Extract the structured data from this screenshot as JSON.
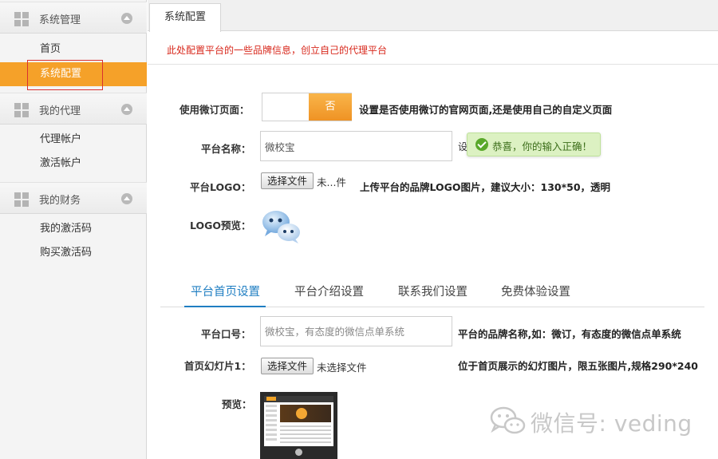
{
  "sidebar": {
    "sections": [
      {
        "title": "系统管理",
        "items": [
          "首页",
          "系统配置"
        ]
      },
      {
        "title": "我的代理",
        "items": [
          "代理帐户",
          "激活帐户"
        ]
      },
      {
        "title": "我的财务",
        "items": [
          "我的激活码",
          "购买激活码"
        ]
      }
    ],
    "active_item": "系统配置"
  },
  "tabbar": {
    "active_tab": "系统配置"
  },
  "notice": "此处配置平台的一些品牌信息，创立自己的代理平台",
  "form": {
    "use_custom_page": {
      "label": "使用微订页面：",
      "toggle_value": "否",
      "hint": "设置是否使用微订的官网页面,还是使用自己的自定义页面"
    },
    "platform_name": {
      "label": "平台名称：",
      "value": "微校宝",
      "hint_cut": "设",
      "success_tip": "恭喜，你的输入正确！"
    },
    "platform_logo": {
      "label": "平台LOGO：",
      "button": "选择文件",
      "status": "未...件",
      "hint": "上传平台的品牌LOGO图片，建议大小：130*50，透明"
    },
    "logo_preview": {
      "label": "LOGO预览："
    }
  },
  "subtabs": [
    "平台首页设置",
    "平台介绍设置",
    "联系我们设置",
    "免费体验设置"
  ],
  "homepage": {
    "slogan": {
      "label": "平台口号：",
      "placeholder": "微校宝，有态度的微信点单系统",
      "hint": "平台的品牌名称,如：微订，有态度的微信点单系统"
    },
    "slide1": {
      "label": "首页幻灯片1：",
      "button": "选择文件",
      "status": "未选择文件",
      "hint": "位于首页展示的幻灯图片，限五张图片,规格290*240"
    },
    "preview": {
      "label": "预览："
    }
  },
  "watermark": "微信号: veding",
  "colors": {
    "accent_orange": "#f5a129",
    "notice_red": "#d8281c",
    "tab_blue": "#1f7ec2",
    "success_green": "#dcf1c2"
  }
}
